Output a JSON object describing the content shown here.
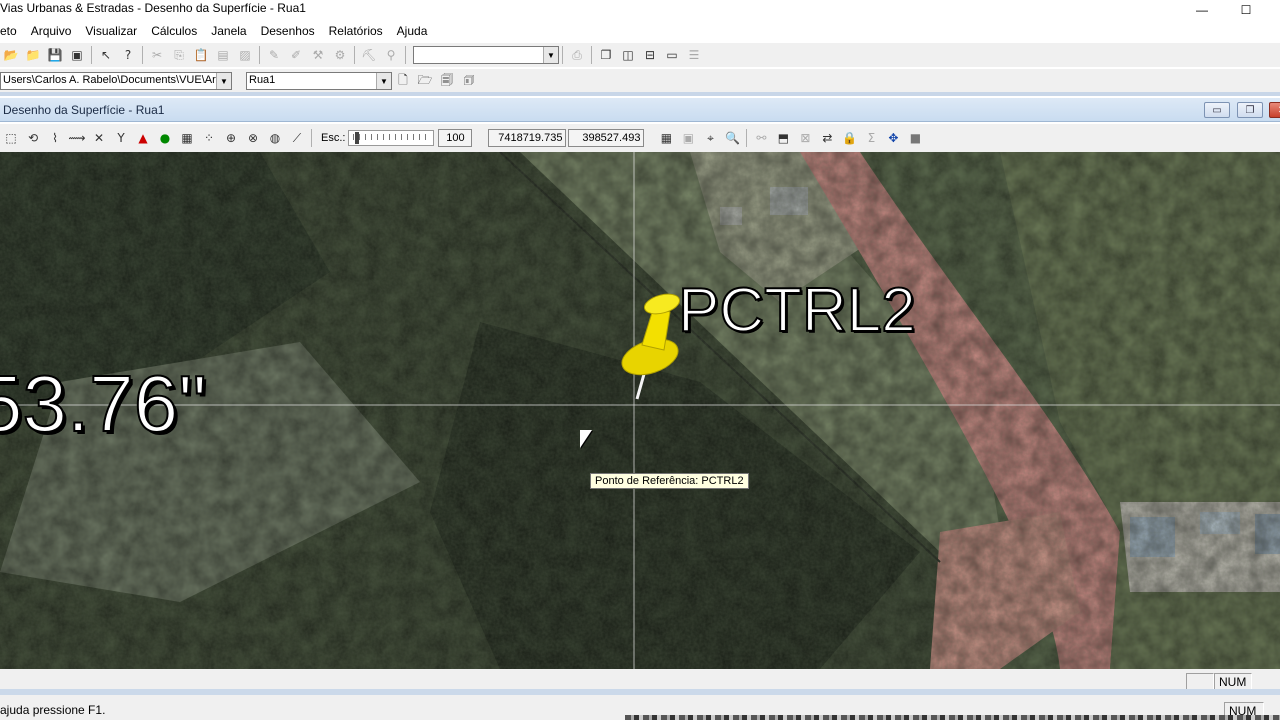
{
  "window": {
    "title": "Vias Urbanas & Estradas -  Desenho da Superfície  - Rua1",
    "minimize": "—",
    "maximize": "☐"
  },
  "menu": [
    "eto",
    "Arquivo",
    "Visualizar",
    "Cálculos",
    "Janela",
    "Desenhos",
    "Relatórios",
    "Ajuda"
  ],
  "toolbar1": {
    "combo_value": ""
  },
  "toolbar2": {
    "path": "Users\\Carlos A. Rabelo\\Documents\\VUE\\Ar",
    "drawing": "Rua1"
  },
  "document": {
    "title": "Desenho da Superfície  - Rua1",
    "min": "▭",
    "restore": "❐",
    "close": "✕"
  },
  "toolbar3": {
    "scale_label": "Esc.:",
    "scale_value": "100",
    "coord_north": "7418719.735",
    "coord_east": "398527.493"
  },
  "map": {
    "label_left": "53.76\"",
    "pin_label": "PCTRL2",
    "tooltip": "Ponto de Referência: PCTRL2"
  },
  "status": {
    "num1": "NUM",
    "help": "ajuda pressione F1.",
    "num2": "NUM"
  },
  "colors": {
    "pin": "#f3e000",
    "tooltip_bg": "#ffffe1",
    "dirt_road": "#d4908a"
  }
}
